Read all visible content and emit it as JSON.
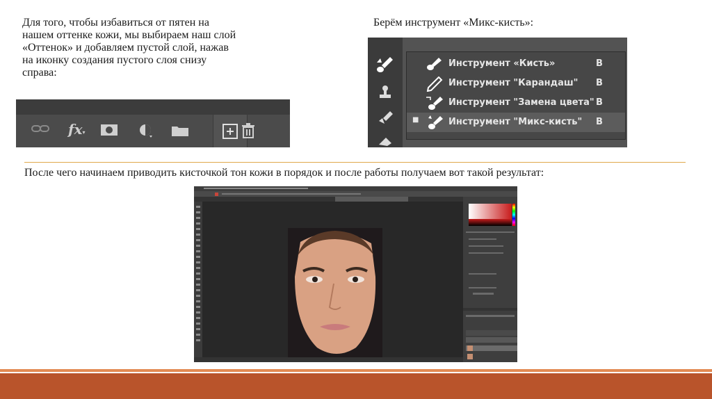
{
  "left_caption": {
    "lines": [
      "Для того, чтобы избавиться от пятен на",
      "нашем оттенке кожи, мы выбираем наш слой",
      "«Оттенок» и добавляем пустой слой, нажав",
      "на иконку создания пустого слоя снизу",
      "справа:"
    ]
  },
  "right_caption": "Берём инструмент «Микс-кисть»:",
  "bottom_caption": "После чего начинаем приводить кисточкой тон кожи в порядок и после работы получаем вот такой результат:",
  "layers_bar": {
    "icons": [
      "link-icon",
      "fx-icon",
      "mask-icon",
      "adjustment-icon",
      "folder-icon",
      "new-layer-icon",
      "trash-icon"
    ],
    "fx_label": "fx"
  },
  "tool_menu": {
    "items": [
      {
        "label": "Инструмент «Кисть»",
        "key": "B",
        "icon": "brush-icon",
        "active": false
      },
      {
        "label": "Инструмент \"Карандаш\"",
        "key": "B",
        "icon": "pencil-icon",
        "active": false
      },
      {
        "label": "Инструмент \"Замена цвета\"",
        "key": "B",
        "icon": "color-replace-icon",
        "active": false
      },
      {
        "label": "Инструмент \"Микс-кисть\"",
        "key": "B",
        "icon": "mixer-brush-icon",
        "active": true
      }
    ],
    "active_bullet": "■"
  },
  "colors": {
    "footer": "#b9542b",
    "footer_line": "#e38a52",
    "rule": "#e0a84a",
    "ps_dark": "#2b2b2b"
  }
}
